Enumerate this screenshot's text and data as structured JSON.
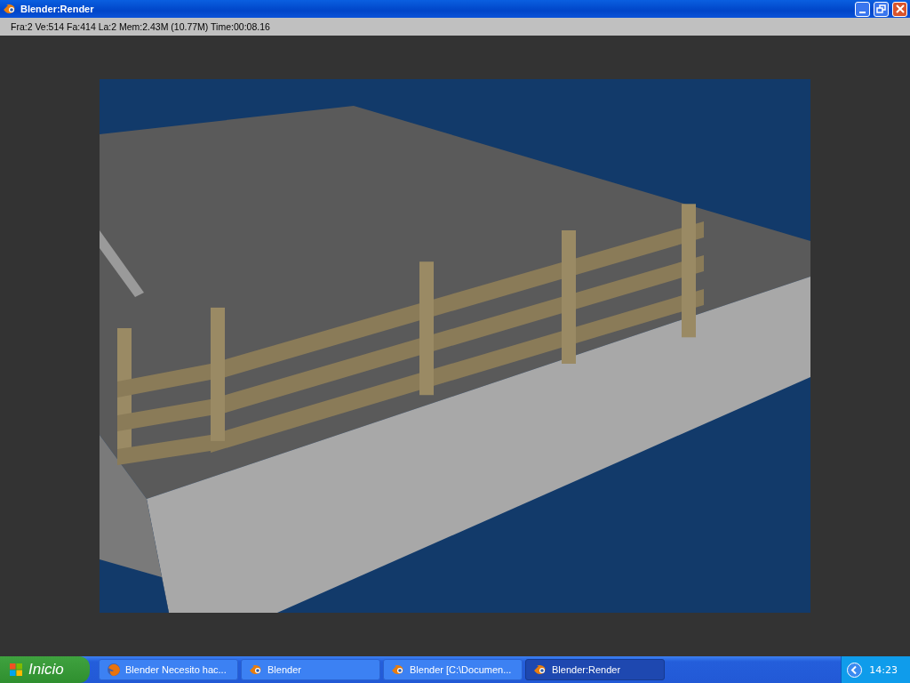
{
  "window": {
    "title": "Blender:Render"
  },
  "status_bar": "Fra:2  Ve:514 Fa:414 La:2 Mem:2.43M (10.77M) Time:00:08.16",
  "taskbar": {
    "start_label": "Inicio",
    "items": [
      {
        "label": "Blender Necesito hac...",
        "kind": "browser",
        "selected": false
      },
      {
        "label": "Blender",
        "kind": "blender",
        "selected": false
      },
      {
        "label": "Blender [C:\\Documen...",
        "kind": "blender",
        "selected": false
      },
      {
        "label": "Blender:Render",
        "kind": "blender",
        "selected": true
      }
    ],
    "clock": "14:23"
  }
}
